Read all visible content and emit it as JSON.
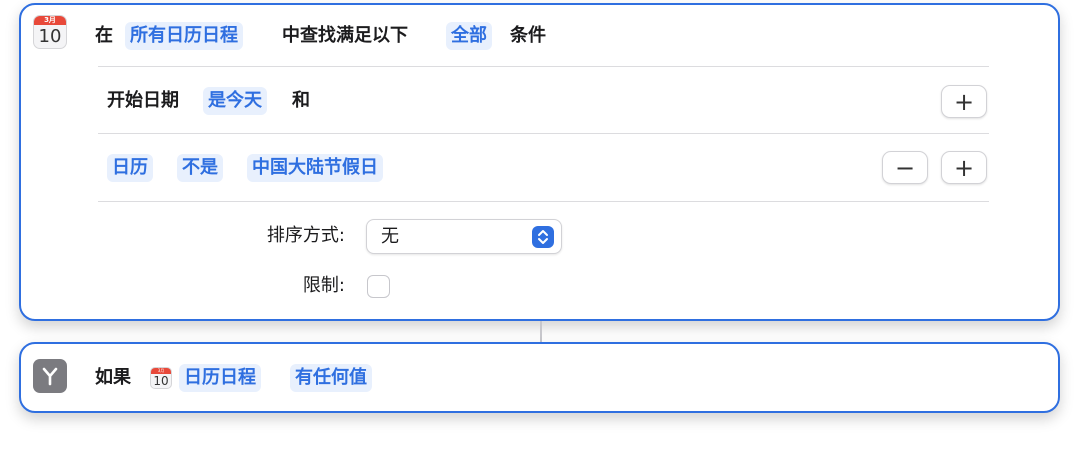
{
  "find_action": {
    "calendar_icon": {
      "name": "calendar-icon",
      "month": "3月",
      "day": "10"
    },
    "prefix": "在",
    "source_token": "所有日历日程",
    "middle": "中查找满足以下",
    "match_token": "全部",
    "suffix": "条件",
    "filters": [
      {
        "field": "开始日期",
        "operator": "是今天",
        "connector": "和"
      },
      {
        "field": "日历",
        "operator": "不是",
        "value": "中国大陆节假日"
      }
    ],
    "sort_label": "排序方式:",
    "sort_value": "无",
    "limit_label": "限制:"
  },
  "if_action": {
    "icon": "branch-icon",
    "label": "如果",
    "calendar_icon": {
      "month": "3月",
      "day": "10"
    },
    "variable_token": "日历日程",
    "condition_token": "有任何值"
  },
  "colors": {
    "accent": "#2f6fe0",
    "token_bg": "#e8f0fd",
    "calendar_red": "#e8493a",
    "if_icon_bg": "#7b7b80"
  },
  "buttons": {
    "add": "+",
    "remove": "−"
  }
}
